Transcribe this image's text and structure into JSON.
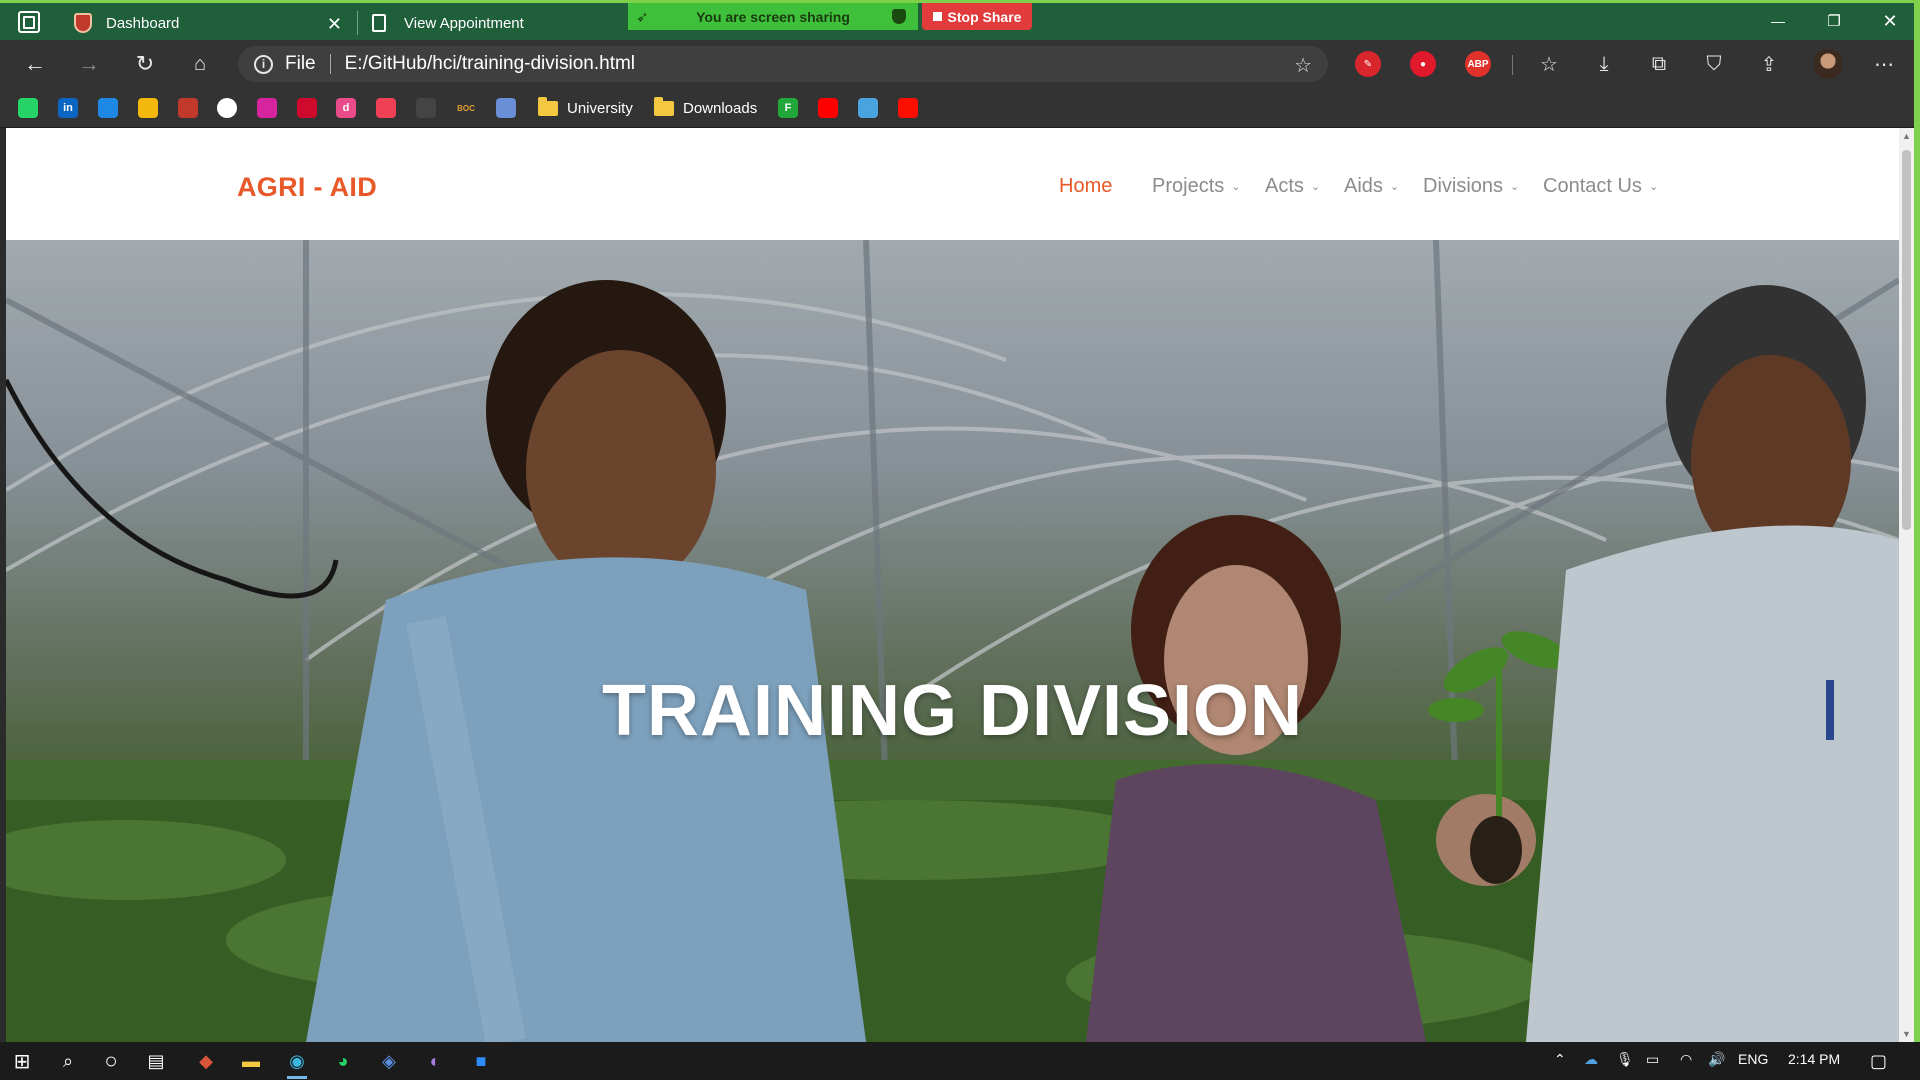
{
  "browser": {
    "tabs": [
      {
        "label": "Dashboard",
        "active": true
      },
      {
        "label": "View Appointment",
        "active": false
      }
    ],
    "share_banner": {
      "text": "You are screen sharing",
      "stop_label": "Stop Share"
    },
    "address": {
      "scheme": "File",
      "url": "E:/GitHub/hci/training-division.html"
    },
    "extensions": [
      {
        "name": "highlighter-extension-icon",
        "color": "#d8262c"
      },
      {
        "name": "lastpass-extension-icon",
        "color": "#e0192b"
      },
      {
        "name": "adblock-plus-extension-icon",
        "color": "#e0312b",
        "text": "ABP"
      }
    ],
    "bookmarks": [
      {
        "name": "whatsapp-bookmark-icon",
        "color": "#25d366"
      },
      {
        "name": "linkedin-bookmark-icon",
        "color": "#0a66c2",
        "text": "in"
      },
      {
        "name": "video-bookmark-icon",
        "color": "#1e88e5"
      },
      {
        "name": "cinema-bookmark-icon",
        "color": "#f2b90c"
      },
      {
        "name": "app-bookmark-icon",
        "color": "#c0392b"
      },
      {
        "name": "github-bookmark-icon",
        "color": "#ffffff"
      },
      {
        "name": "instagram-bookmark-icon",
        "color": "#d6249f"
      },
      {
        "name": "huawei-bookmark-icon",
        "color": "#cf0a2c"
      },
      {
        "name": "dribbble-bookmark-icon",
        "color": "#ea4c89",
        "text": "d"
      },
      {
        "name": "pocket-bookmark-icon",
        "color": "#ef4056"
      },
      {
        "name": "cv-bookmark-icon",
        "color": "#444444"
      },
      {
        "name": "bookmark-boc-icon",
        "color": "#333333",
        "text": "BOC"
      },
      {
        "name": "emblem-bookmark-icon",
        "color": "#6b8fd6"
      }
    ],
    "bookmark_folders": [
      "University",
      "Downloads"
    ],
    "bookmarks_tail": [
      {
        "name": "freshworks-bookmark-icon",
        "color": "#22a83a",
        "text": "F"
      },
      {
        "name": "youtube-bookmark-icon",
        "color": "#ff0000"
      },
      {
        "name": "x-bookmark-icon",
        "color": "#4aa3df"
      },
      {
        "name": "adobe-bookmark-icon",
        "color": "#fa0f00"
      }
    ]
  },
  "site": {
    "brand": "AGRI - AID",
    "nav": [
      {
        "label": "Home",
        "active": true,
        "dropdown": false
      },
      {
        "label": "Projects",
        "active": false,
        "dropdown": true
      },
      {
        "label": "Acts",
        "active": false,
        "dropdown": true
      },
      {
        "label": "Aids",
        "active": false,
        "dropdown": true
      },
      {
        "label": "Divisions",
        "active": false,
        "dropdown": true
      },
      {
        "label": "Contact Us",
        "active": false,
        "dropdown": true
      }
    ],
    "hero": {
      "title": "TRAINING DIVISION"
    },
    "accent": "#e8592a"
  },
  "taskbar": {
    "language": "ENG",
    "time": "2:14 PM"
  }
}
